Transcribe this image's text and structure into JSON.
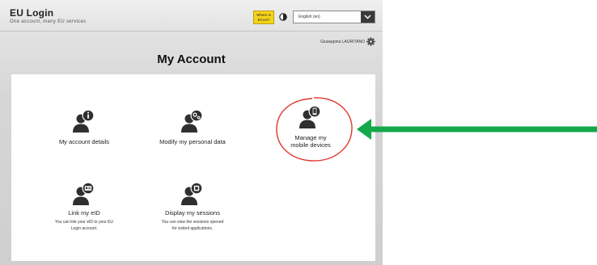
{
  "header": {
    "title": "EU Login",
    "subtitle": "One account, many EU services",
    "ecas_badge": "Where is ECAS?",
    "language": "English (en)"
  },
  "user": {
    "name": "Giuseppina LAURITANO"
  },
  "page_title": "My Account",
  "tiles": [
    {
      "label": "My account details",
      "icon": "user-info-icon"
    },
    {
      "label": "Modify my personal data",
      "icon": "user-settings-icon"
    },
    {
      "label": "Manage my mobile devices",
      "icon": "user-mobile-icon"
    },
    {
      "label": "Link my eID",
      "description": "You can link your eID to your EU Login account.",
      "icon": "user-id-card-icon"
    },
    {
      "label": "Display my sessions",
      "description": "You can view the sessions opened for visited applications.",
      "icon": "user-sessions-icon"
    }
  ],
  "annotations": {
    "circle_color": "#e0342c",
    "arrow_color": "#14a84b"
  }
}
